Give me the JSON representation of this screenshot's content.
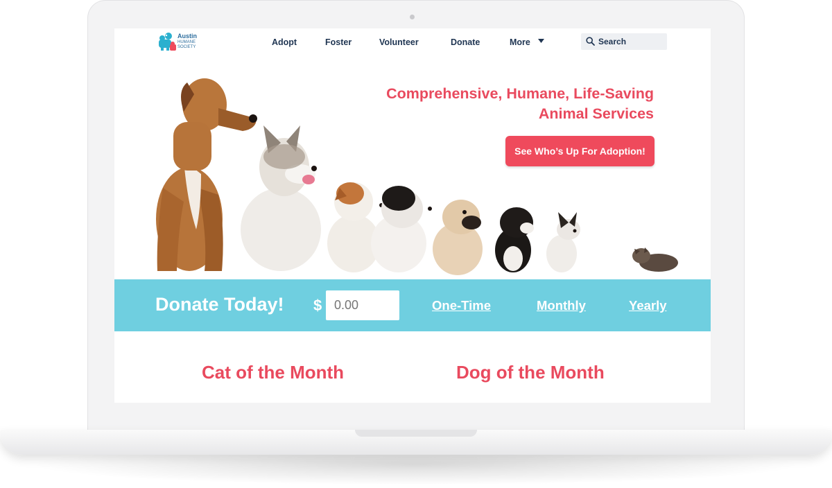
{
  "brand": {
    "name": "Austin",
    "sub": "HUMANE SOCIETY",
    "colors": {
      "accent": "#e94a5e",
      "band": "#6fcfe0",
      "nav_text": "#1f3552",
      "logo_blue": "#2bb0cf",
      "logo_red": "#ef4a5c"
    }
  },
  "nav": {
    "items": [
      {
        "label": "Adopt"
      },
      {
        "label": "Foster"
      },
      {
        "label": "Volunteer"
      },
      {
        "label": "Donate"
      },
      {
        "label": "More"
      }
    ],
    "more_icon": "caret-down-icon",
    "search": {
      "placeholder": "Search",
      "icon": "search-icon"
    }
  },
  "hero": {
    "title_line1": "Comprehensive, Humane, Life-Saving",
    "title_line2": "Animal Services",
    "cta_label": "See Who’s Up For Adoption!",
    "image": "row-of-dogs-and-kitten-photo"
  },
  "donate": {
    "title": "Donate Today!",
    "currency": "$",
    "amount_placeholder": "0.00",
    "frequencies": [
      "One-Time",
      "Monthly",
      "Yearly"
    ]
  },
  "featured": {
    "cat_title": "Cat of the Month",
    "dog_title": "Dog of the Month"
  }
}
